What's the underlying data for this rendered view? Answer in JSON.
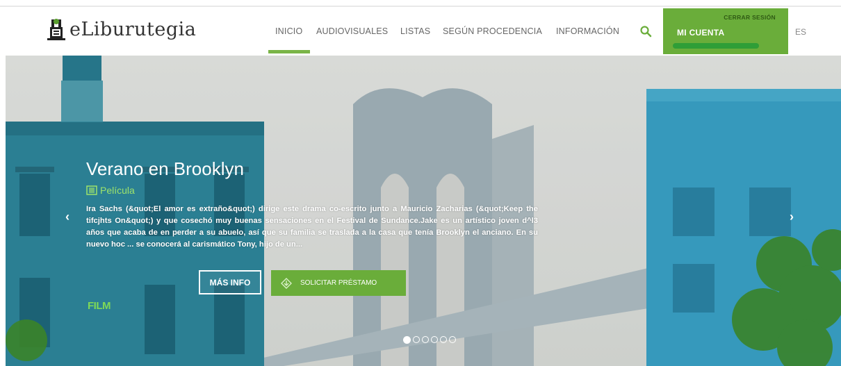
{
  "brand": {
    "name": "eLiburutegia"
  },
  "nav": {
    "items": [
      {
        "label": "INICIO",
        "active": true
      },
      {
        "label": "AUDIOVISUALES"
      },
      {
        "label": "LISTAS"
      },
      {
        "label": "SEGÚN PROCEDENCIA"
      },
      {
        "label": "INFORMACIÓN"
      }
    ],
    "search_icon": "search-icon"
  },
  "account": {
    "logout_label": "CERRAR SESIÓN",
    "label": "MI CUENTA"
  },
  "language": "ES",
  "slide": {
    "title": "Verano en Brooklyn",
    "type": "Película",
    "description": "Ira Sachs (&quot;El amor es extraño&quot;) dirige este drama co-escrito junto a Mauricio Zacharias (&quot;Keep the tifcjhts On&quot;) y que cosechó muy buenas sensaciones en el Festival de Sundance.Jake es un artístico joven d^l3 años que acaba de en perder a su abuelo, así que su familia se traslada a la casa que tenía Brooklyn el anciano. En su nuevo hoc ... se conocerá al carismático Tony, hijo de un...",
    "more_info_label": "MÁS INFO",
    "loan_label": "SOLICITAR PRÉSTAMO",
    "badge": "FILM"
  },
  "carousel": {
    "total": 6,
    "active_index": 0
  },
  "colors": {
    "accent": "#6aad3a",
    "account_underline": "#2f9e37",
    "nav_text": "#666666"
  }
}
